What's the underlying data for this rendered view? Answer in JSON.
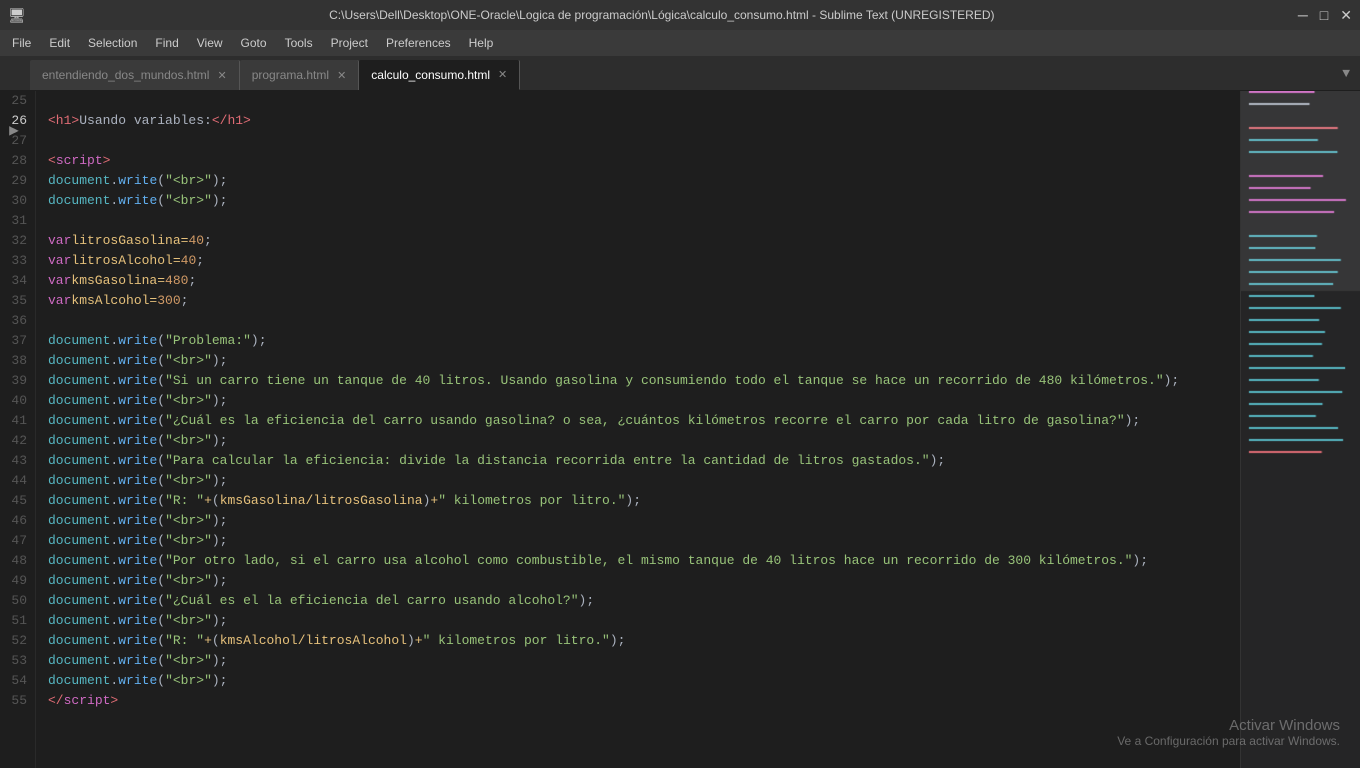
{
  "titlebar": {
    "title": "C:\\Users\\Dell\\Desktop\\ONE-Oracle\\Logica de programación\\Lógica\\calculo_consumo.html - Sublime Text (UNREGISTERED)",
    "min_btn": "─",
    "max_btn": "□",
    "close_btn": "✕"
  },
  "menubar": {
    "items": [
      "File",
      "Edit",
      "Selection",
      "Find",
      "View",
      "Goto",
      "Tools",
      "Project",
      "Preferences",
      "Help"
    ]
  },
  "tabs": [
    {
      "label": "entendiendo_dos_mundos.html",
      "active": false
    },
    {
      "label": "programa.html",
      "active": false
    },
    {
      "label": "calculo_consumo.html",
      "active": true
    }
  ],
  "activate_windows": {
    "line1": "Activar Windows",
    "line2": "Ve a Configuración para activar Windows."
  }
}
